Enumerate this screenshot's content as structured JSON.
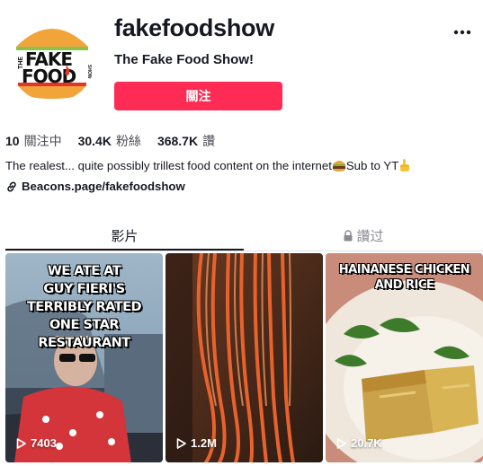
{
  "profile": {
    "avatar_text_line1": "THE",
    "avatar_text_line2": "FAKE",
    "avatar_text_line3": "FOOD",
    "avatar_text_line4": "SHOW",
    "username": "fakefoodshow",
    "nickname": "The Fake Food Show!",
    "follow_label": "關注",
    "more_icon": "more-horizontal-icon"
  },
  "stats": {
    "following_count": "10",
    "following_label": "關注中",
    "followers_count": "30.4K",
    "followers_label": "粉絲",
    "likes_count": "368.7K",
    "likes_label": "讚"
  },
  "bio": {
    "text": "The realest... quite possibly trillest food content on the internet",
    "text2": "Sub to YT",
    "emoji1": "hamburger-emoji",
    "emoji2": "point-up-emoji"
  },
  "link": {
    "icon": "link-icon",
    "text": "Beacons.page/fakefoodshow"
  },
  "tabs": [
    {
      "label": "影片",
      "active": true
    },
    {
      "label": "讚过",
      "active": false,
      "icon": "lock-icon"
    }
  ],
  "videos": [
    {
      "title_lines": [
        "WE ATE AT",
        "GUY FIERI'S",
        "TERRIBLY RATED",
        "ONE STAR",
        "RESTAURANT"
      ],
      "views": "7403"
    },
    {
      "title_lines": [],
      "views": "1.2M"
    },
    {
      "title_lines": [
        "HAINANESE CHICKEN",
        "AND RICE"
      ],
      "views": "20.7K"
    }
  ],
  "colors": {
    "accent": "#fe2c55",
    "text": "#161823",
    "muted": "#8a8b91"
  }
}
